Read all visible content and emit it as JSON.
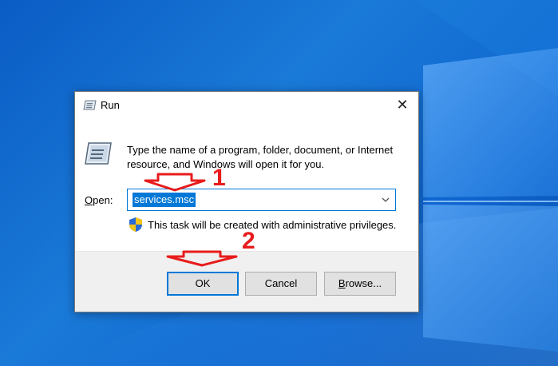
{
  "dialog": {
    "title": "Run",
    "description": "Type the name of a program, folder, document, or Internet resource, and Windows will open it for you.",
    "open_label": "Open:",
    "open_value": "services.msc",
    "admin_note": "This task will be created with administrative privileges.",
    "buttons": {
      "ok": "OK",
      "cancel": "Cancel",
      "browse": "Browse..."
    }
  },
  "annotations": {
    "step1": "1",
    "step2": "2",
    "color": "#e81c1c"
  },
  "icons": {
    "title": "run-icon",
    "close": "close-icon",
    "big": "run-large-icon",
    "dropdown": "chevron-down-icon",
    "shield": "uac-shield-icon"
  },
  "colors": {
    "accent": "#0078d7",
    "desktop": "#0f66cf"
  }
}
